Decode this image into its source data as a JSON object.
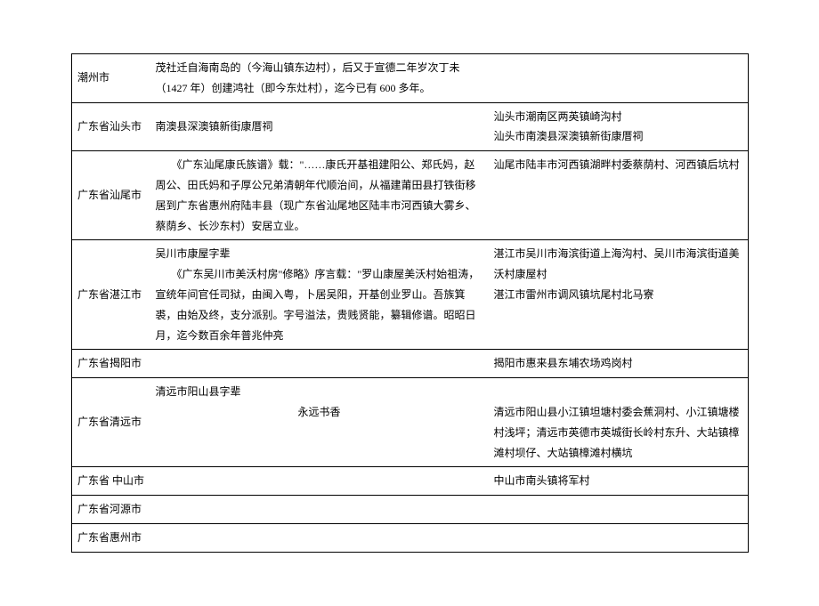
{
  "rows": [
    {
      "region": "潮州市",
      "desc_lines": [
        "茂社迁自海南岛的（今海山镇东边村），后又于宣德二年岁次丁未（1427 年）创建鸿社（即今东灶村），迄今已有 600 多年。"
      ],
      "loc": ""
    },
    {
      "region": "广东省汕头市",
      "desc_lines": [
        "南澳县深澳镇新街康厝祠"
      ],
      "loc": "汕头市潮南区两英镇崎沟村\n汕头市南澳县深澳镇新街康厝祠"
    },
    {
      "region": "广东省汕尾市",
      "desc_lines": [
        "　　《广东汕尾康氏族谱》载：\"……康氏开基祖建阳公、郑氏妈，赵周公、田氏妈和子厚公兄弟清朝年代顺治间，从福建莆田县打铁街移居到广东省惠州府陆丰县（现广东省汕尾地区陆丰市河西镇大雾乡、蔡荫乡、长沙东村）安居立业。"
      ],
      "loc": "汕尾市陆丰市河西镇湖畔村委蔡荫村、河西镇后坑村"
    },
    {
      "region": "广东省湛江市",
      "desc_lines": [
        "吴川市康屋字辈",
        "　　《广东吴川市美沃村房\"修略》序言载：\"罗山康屋美沃村始祖涛，宣统年间官任司狱，由闽入粤，卜居吴阳，开基创业罗山。吾族箕裘，由始及终，支分派别。字号溢法，贵贱贤能，纂辑修谱。昭昭日月，迄今数百余年普兆仲亮"
      ],
      "loc": "湛江市吴川市海滨街道上海沟村、吴川市海滨街道美沃村康屋村\n湛江市雷州市调风镇坑尾村北马寮"
    },
    {
      "region": "广东省揭阳市",
      "desc_lines": [],
      "loc": "揭阳市惠来县东埔农场鸡岗村"
    },
    {
      "region": "广东省清远市",
      "desc_lines": [
        "清远市阳山县字辈",
        "",
        "永远书香"
      ],
      "desc_center_last": true,
      "loc": "\n清远市阳山县小江镇坦塘村委会蕉洞村、小江镇塘楼村浅坪；清远市英德市英城街长岭村东升、大站镇樟滩村坝仔、大站镇樟滩村横坑"
    },
    {
      "region": "广东省 中山市",
      "desc_lines": [],
      "loc": "中山市南头镇将军村"
    },
    {
      "region": "广东省河源市",
      "desc_lines": [],
      "loc": ""
    },
    {
      "region": "广东省惠州市",
      "desc_lines": [],
      "loc": ""
    }
  ]
}
